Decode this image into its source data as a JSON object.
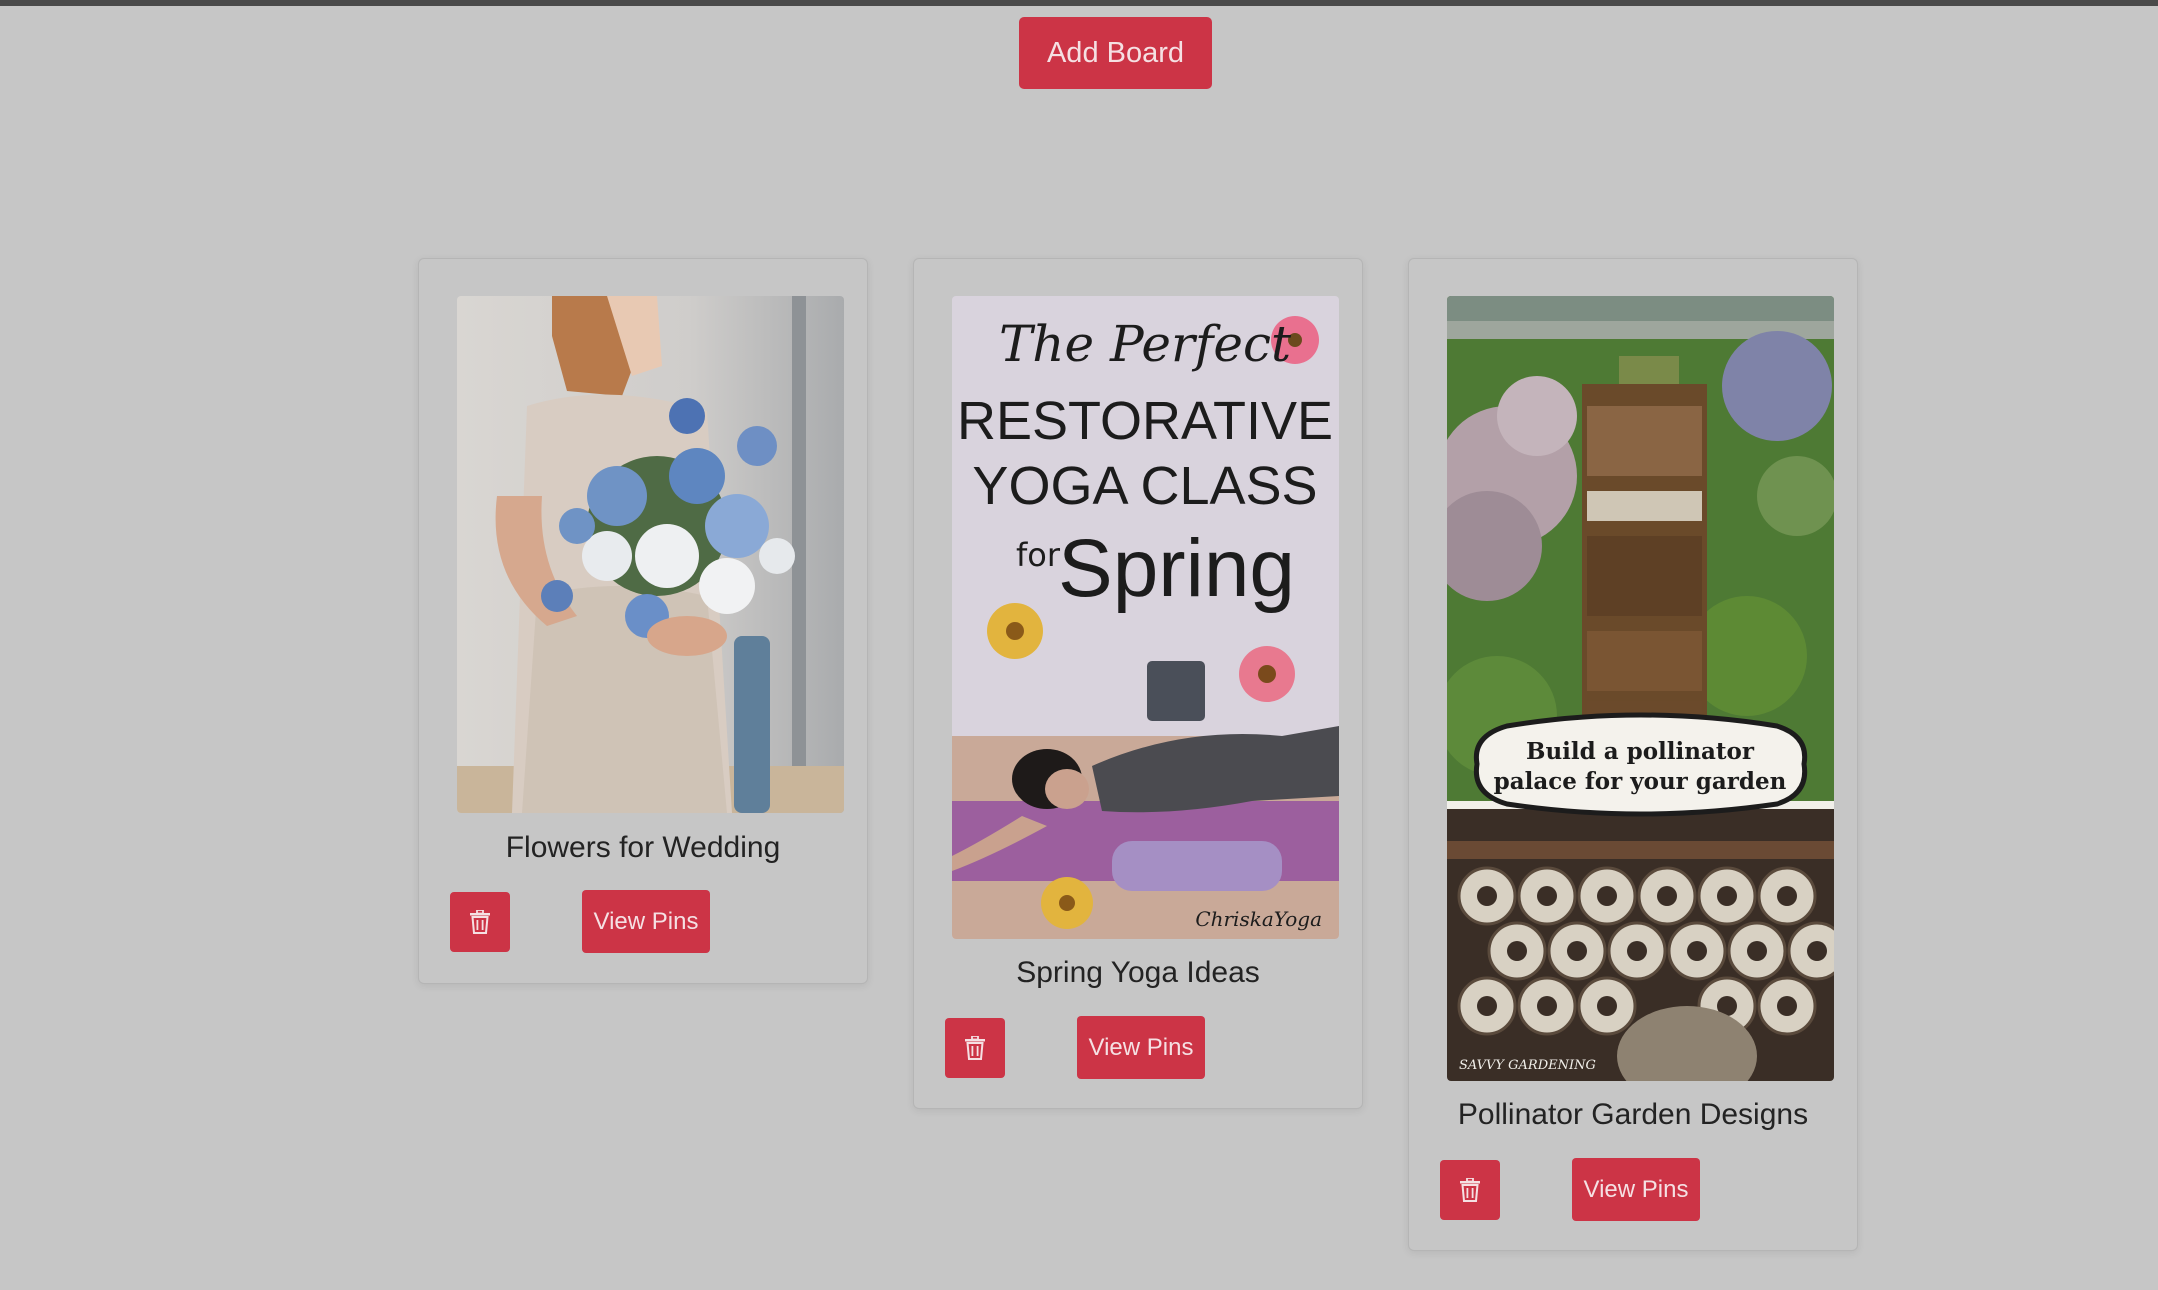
{
  "header": {
    "add_board_label": "Add Board"
  },
  "boards": [
    {
      "title": "Flowers for Wedding",
      "delete_icon": "trash-icon",
      "view_label": "View Pins"
    },
    {
      "title": "Spring Yoga Ideas",
      "delete_icon": "trash-icon",
      "view_label": "View Pins",
      "image_text": {
        "script_line": "The Perfect",
        "line1": "RESTORATIVE",
        "line2": "YOGA CLASS",
        "for": "for",
        "spring": "Spring",
        "signature": "ChriskaYoga"
      }
    },
    {
      "title": "Pollinator Garden Designs",
      "delete_icon": "trash-icon",
      "view_label": "View Pins",
      "image_text": {
        "banner_line1": "Build a pollinator",
        "banner_line2": "palace for your garden",
        "watermark": "SAVVY GARDENING"
      }
    }
  ],
  "colors": {
    "background": "#c6c6c6",
    "button": "#cc3446",
    "button_text": "#f5e0e3",
    "title_text": "#232323"
  }
}
